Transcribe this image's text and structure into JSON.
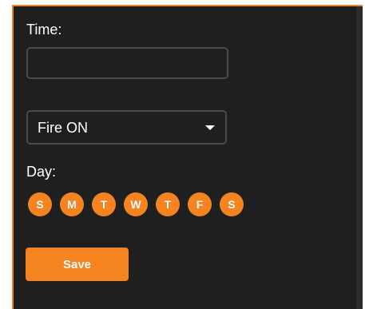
{
  "form": {
    "time_label": "Time:",
    "time_value": "",
    "time_placeholder": "",
    "action_select": {
      "selected": "Fire ON"
    },
    "day_label": "Day:",
    "days": [
      "S",
      "M",
      "T",
      "W",
      "T",
      "F",
      "S"
    ],
    "save_label": "Save"
  },
  "colors": {
    "accent": "#f5831f",
    "panel_background": "#1f1f1f",
    "border": "#4b4b4b"
  },
  "icons": {
    "select_caret": "caret-down-icon"
  }
}
